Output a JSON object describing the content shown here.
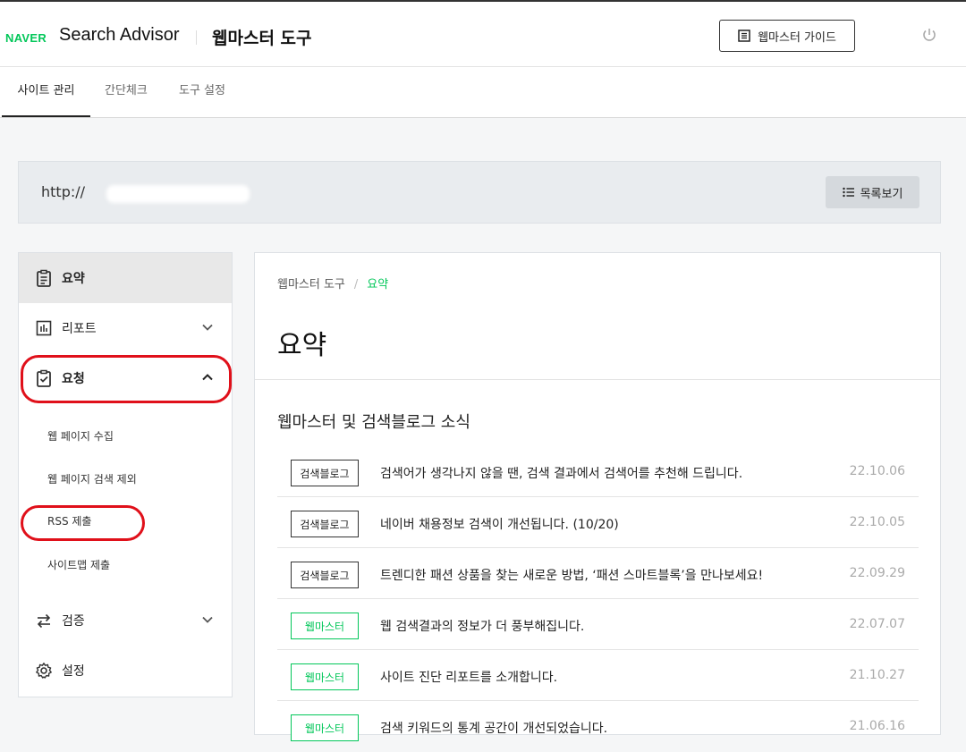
{
  "header": {
    "brand": "NAVER",
    "app_name": "Search Advisor",
    "tool_name": "웹마스터 도구",
    "guide_button": "웹마스터 가이드"
  },
  "tabs": [
    {
      "label": "사이트 관리"
    },
    {
      "label": "간단체크"
    },
    {
      "label": "도구 설정"
    }
  ],
  "site": {
    "url_prefix": "http://",
    "list_button": "목록보기"
  },
  "sidebar": {
    "items": [
      {
        "label": "요약"
      },
      {
        "label": "리포트"
      },
      {
        "label": "요청"
      },
      {
        "label": "검증"
      },
      {
        "label": "설정"
      }
    ],
    "sub_items": [
      {
        "label": "웹 페이지 수집"
      },
      {
        "label": "웹 페이지 검색 제외"
      },
      {
        "label": "RSS 제출"
      },
      {
        "label": "사이트맵 제출"
      }
    ]
  },
  "main": {
    "breadcrumb": {
      "root": "웹마스터 도구",
      "sep": "/",
      "current": "요약"
    },
    "title": "요약",
    "section_title": "웹마스터 및 검색블로그 소식",
    "news": [
      {
        "badge": "검색블로그",
        "title": "검색어가 생각나지 않을 땐, 검색 결과에서 검색어를 추천해 드립니다.",
        "date": "22.10.06"
      },
      {
        "badge": "검색블로그",
        "title": "네이버 채용정보 검색이 개선됩니다. (10/20)",
        "date": "22.10.05"
      },
      {
        "badge": "검색블로그",
        "title": "트렌디한 패션 상품을 찾는 새로운 방법, ‘패션 스마트블록’을 만나보세요!",
        "date": "22.09.29"
      },
      {
        "badge": "웹마스터",
        "title": "웹 검색결과의 정보가 더 풍부해집니다.",
        "date": "22.07.07"
      },
      {
        "badge": "웹마스터",
        "title": "사이트 진단 리포트를 소개합니다.",
        "date": "21.10.27"
      },
      {
        "badge": "웹마스터",
        "title": "검색 키워드의 통계 공간이 개선되었습니다.",
        "date": "21.06.16"
      }
    ]
  },
  "colors": {
    "accent": "#03c75a",
    "highlight": "#e0101a"
  }
}
